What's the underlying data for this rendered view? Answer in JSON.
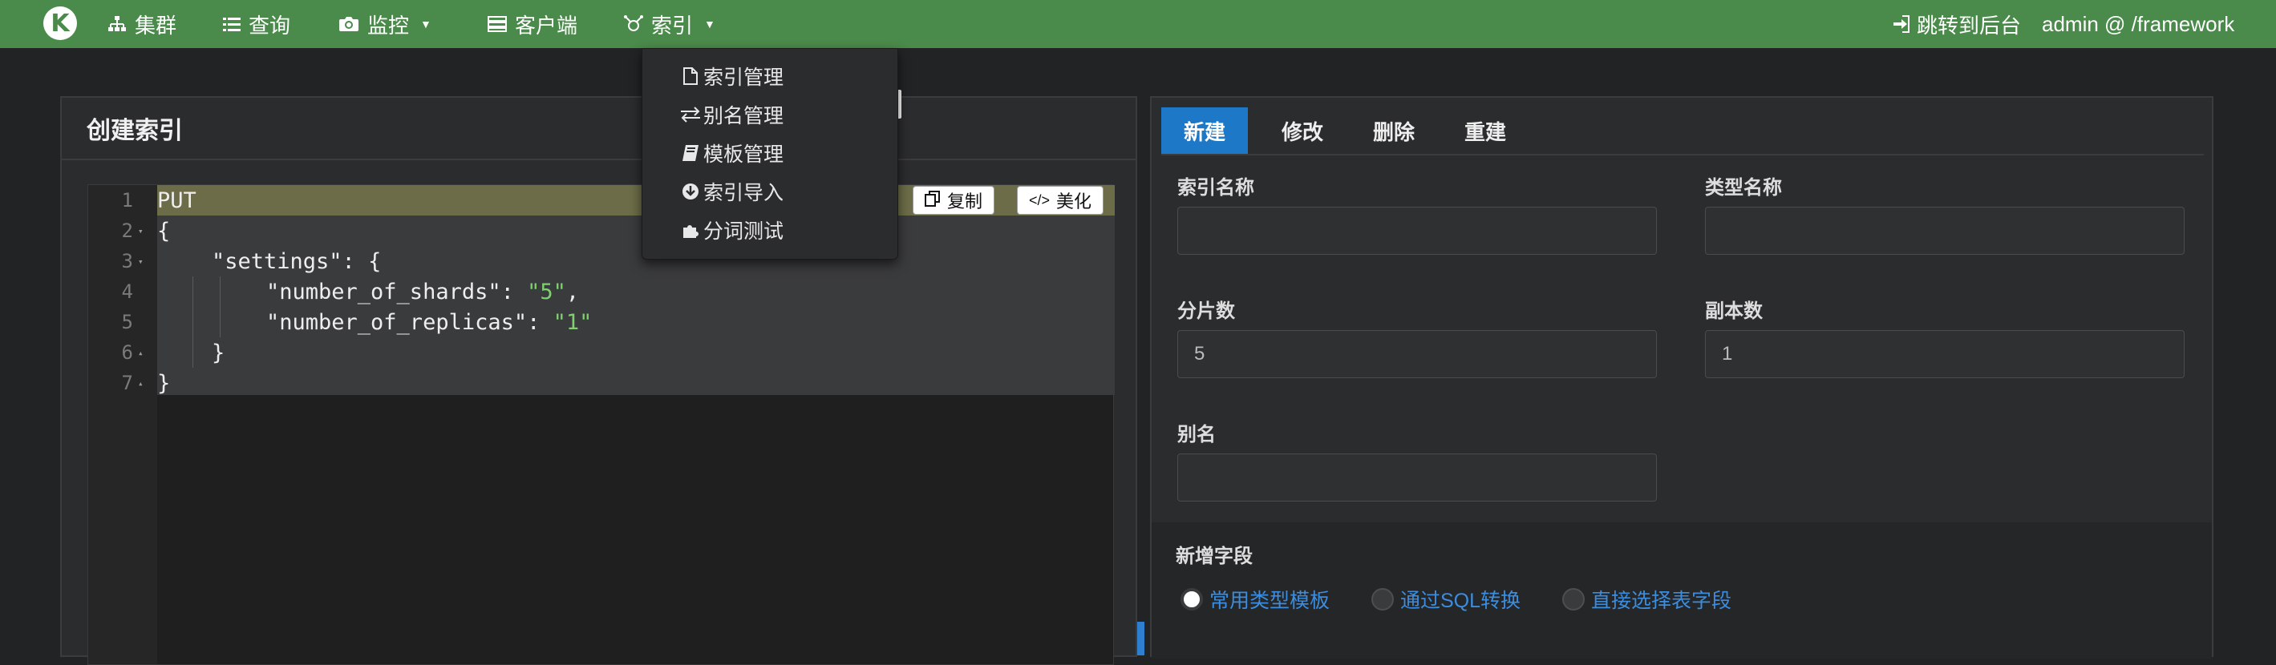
{
  "navbar": {
    "logo": "K",
    "items": [
      {
        "label": "集群",
        "icon": "sitemap-icon"
      },
      {
        "label": "查询",
        "icon": "list-icon"
      },
      {
        "label": "监控",
        "icon": "camera-icon"
      },
      {
        "label": "客户端",
        "icon": "server-icon"
      },
      {
        "label": "索引",
        "icon": "index-icon"
      }
    ],
    "backend_link": "跳转到后台",
    "user": "admin @ /framework"
  },
  "dropdown": {
    "items": [
      {
        "label": "索引管理",
        "icon": "file-icon"
      },
      {
        "label": "别名管理",
        "icon": "exchange-icon"
      },
      {
        "label": "模板管理",
        "icon": "book-icon"
      },
      {
        "label": "索引导入",
        "icon": "download-icon"
      },
      {
        "label": "分词测试",
        "icon": "puzzle-icon"
      }
    ]
  },
  "left_panel": {
    "title": "创建索引",
    "copy_button": "复制",
    "beautify_button": "美化",
    "line_numbers": [
      "1",
      "2",
      "3",
      "4",
      "5",
      "6",
      "7"
    ],
    "code": {
      "line1": "PUT",
      "line2": "{",
      "line3": "\"settings\": {",
      "line4_key": "\"number_of_shards\": ",
      "line4_val": "\"5\"",
      "line4_end": ",",
      "line5_key": "\"number_of_replicas\": ",
      "line5_val": "\"1\"",
      "line6": "}",
      "line7": "}"
    }
  },
  "right_panel": {
    "tabs": [
      "新建",
      "修改",
      "删除",
      "重建"
    ],
    "active_tab": "新建",
    "fields": {
      "index_name": {
        "label": "索引名称",
        "value": ""
      },
      "type_name": {
        "label": "类型名称",
        "value": ""
      },
      "shards": {
        "label": "分片数",
        "value": "5"
      },
      "replicas": {
        "label": "副本数",
        "value": "1"
      },
      "alias": {
        "label": "别名",
        "value": ""
      }
    },
    "new_field_title": "新增字段",
    "radio_options": [
      {
        "label": "常用类型模板",
        "checked": true
      },
      {
        "label": "通过SQL转换",
        "checked": false
      },
      {
        "label": "直接选择表字段",
        "checked": false
      }
    ]
  },
  "colors": {
    "navbar": "#4a8a4a",
    "accent_tab": "#1e78c8",
    "link": "#3a8de0",
    "string": "#7fd16f"
  }
}
